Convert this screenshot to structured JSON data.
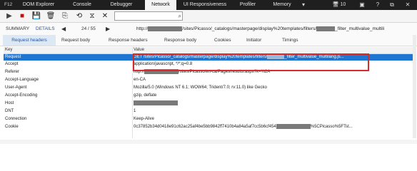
{
  "topbar": {
    "f12": "F12",
    "tabs": [
      "DOM Explorer",
      "Console",
      "Debugger",
      "Network",
      "UI Responsiveness",
      "Profiler",
      "Memory"
    ],
    "active_tab": "Network",
    "tab_count": "10"
  },
  "toolbar": {
    "search_placeholder": ""
  },
  "summary": {
    "summary_label": "SUMMARY",
    "details_label": "DETAILS",
    "counter": "24 / 55",
    "url_prefix": "http://",
    "url_middle": "/sites/Picasso/_catalogs/masterpage/display%20templates/filters/",
    "url_suffix": "_filter_multivalue_multili"
  },
  "subtabs": [
    "Request headers",
    "Request body",
    "Response headers",
    "Response body",
    "Cookies",
    "Initiator",
    "Timings"
  ],
  "active_subtab": "Request headers",
  "table": {
    "col_key": "Key",
    "col_value": "Value",
    "rows": [
      {
        "key": "Request",
        "value_a": "GET /sites/Picasso/_catalogs/masterpage/display%20templates/filters/",
        "value_b": "_filter_multivalue_multilang.js..."
      },
      {
        "key": "Accept",
        "value_a": "application/javascript, */*;q=0.8",
        "value_b": ""
      },
      {
        "key": "Referer",
        "value_a": "http://",
        "value_b": "/sites/Picasso/en-ca/Pages/results.aspx?k=%2A"
      },
      {
        "key": "Accept-Language",
        "value_a": "en-CA",
        "value_b": ""
      },
      {
        "key": "User-Agent",
        "value_a": "Mozilla/5.0 (Windows NT 6.1; WOW64; Trident/7.0; rv:11.0) like Gecko",
        "value_b": ""
      },
      {
        "key": "Accept-Encoding",
        "value_a": "gzip, deflate",
        "value_b": ""
      },
      {
        "key": "Host",
        "value_a": "",
        "value_b": ""
      },
      {
        "key": "DNT",
        "value_a": "1",
        "value_b": ""
      },
      {
        "key": "Connection",
        "value_a": "Keep-Alive",
        "value_b": ""
      },
      {
        "key": "Cookie",
        "value_a": "0c37852b34d0418e91c62ac25af4be5bb9842ff7410b4a84a5af7cc5b6cf454",
        "value_b": "%5CPicasso%5FTst..."
      }
    ]
  },
  "colors": {
    "accent": "#1a56b3",
    "selection": "#1e76d2",
    "highlight_border": "#d62b2b",
    "topbar": "#1f1f1f"
  }
}
